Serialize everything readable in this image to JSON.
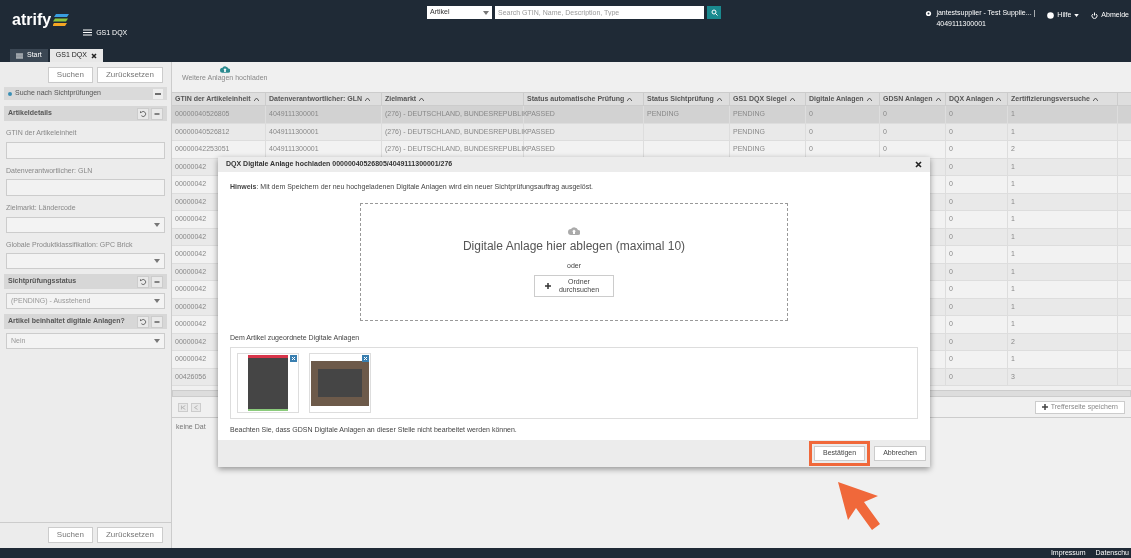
{
  "header": {
    "logo": "atrify",
    "app_title": "GS1 DQX",
    "search": {
      "scope": "Artikel",
      "placeholder": "Search GTIN, Name, Description, Type"
    },
    "user": {
      "name": "jantestsupplier - Test Supplie... |",
      "gln": "4049111300001"
    },
    "help": "Hilfe",
    "logout": "Abmelde"
  },
  "tabs": [
    {
      "label": "Start",
      "selected": false,
      "closable": false
    },
    {
      "label": "GS1 DQX",
      "selected": true,
      "closable": true
    }
  ],
  "sidebar": {
    "top_buttons": [
      "Suchen",
      "Zurücksetzen"
    ],
    "title": "Suche nach Sichtprüfungen",
    "expanded": true,
    "sections": [
      {
        "title": "Artikeldetails",
        "fields": [
          {
            "kind": "text",
            "label": "GTIN der Artikeleinheit"
          },
          {
            "kind": "text",
            "label": "Datenverantwortlicher: GLN"
          },
          {
            "kind": "select",
            "label": "Zielmarkt: Ländercode"
          },
          {
            "kind": "select",
            "label": "Globale Produktklassifikation: GPC Brick"
          }
        ]
      },
      {
        "title": "Sichtprüfungsstatus",
        "fields": [
          {
            "kind": "select",
            "value": "(PENDING) - Ausstehend"
          }
        ]
      },
      {
        "title": "Artikel beinhaltet digitale Anlagen?",
        "fields": [
          {
            "kind": "select",
            "value": "Nein"
          }
        ]
      }
    ],
    "bottom_buttons": [
      "Suchen",
      "Zurücksetzen"
    ]
  },
  "toolbar": {
    "upload_label": "Weitere Anlagen hochladen"
  },
  "table": {
    "columns": [
      "GTIN der Artikeleinheit",
      "Datenverantwortlicher: GLN",
      "Zielmarkt",
      "Status automatische Prüfung",
      "Status Sichtprüfung",
      "GS1 DQX Siegel",
      "Digitale Anlagen",
      "GDSN Anlagen",
      "DQX Anlagen",
      "Zertifizierungsversuche"
    ],
    "rows": [
      {
        "selected": true,
        "cells": [
          "00000040526805",
          "4049111300001",
          "(276) - DEUTSCHLAND, BUNDESREPUBLIK",
          "PASSED",
          "PENDING",
          "PENDING",
          "0",
          "0",
          "0",
          "1"
        ]
      },
      {
        "selected": false,
        "cells": [
          "00000040526812",
          "4049111300001",
          "(276) - DEUTSCHLAND, BUNDESREPUBLIK",
          "PASSED",
          null,
          "PENDING",
          "0",
          "0",
          "0",
          "1"
        ]
      },
      {
        "selected": false,
        "cells": [
          "00000042253051",
          "4049111300001",
          "(276) - DEUTSCHLAND, BUNDESREPUBLIK",
          "PASSED",
          null,
          "PENDING",
          "0",
          "0",
          "0",
          "2"
        ]
      },
      {
        "selected": false,
        "cells": [
          "00000042",
          null,
          null,
          null,
          null,
          null,
          null,
          null,
          "0",
          "1"
        ]
      },
      {
        "selected": false,
        "cells": [
          "00000042",
          null,
          null,
          null,
          null,
          null,
          null,
          null,
          "0",
          "1"
        ]
      },
      {
        "selected": false,
        "cells": [
          "00000042",
          null,
          null,
          null,
          null,
          null,
          null,
          null,
          "0",
          "1"
        ]
      },
      {
        "selected": false,
        "cells": [
          "00000042",
          null,
          null,
          null,
          null,
          null,
          null,
          null,
          "0",
          "1"
        ]
      },
      {
        "selected": false,
        "cells": [
          "00000042",
          null,
          null,
          null,
          null,
          null,
          null,
          null,
          "0",
          "1"
        ]
      },
      {
        "selected": false,
        "cells": [
          "00000042",
          null,
          null,
          null,
          null,
          null,
          null,
          null,
          "0",
          "1"
        ]
      },
      {
        "selected": false,
        "cells": [
          "00000042",
          null,
          null,
          null,
          null,
          null,
          null,
          null,
          "0",
          "1"
        ]
      },
      {
        "selected": false,
        "cells": [
          "00000042",
          null,
          null,
          null,
          null,
          null,
          null,
          null,
          "0",
          "1"
        ]
      },
      {
        "selected": false,
        "cells": [
          "00000042",
          null,
          null,
          null,
          null,
          null,
          null,
          null,
          "0",
          "1"
        ]
      },
      {
        "selected": false,
        "cells": [
          "00000042",
          null,
          null,
          null,
          null,
          null,
          null,
          null,
          "0",
          "1"
        ]
      },
      {
        "selected": false,
        "cells": [
          "00000042",
          null,
          null,
          null,
          null,
          null,
          null,
          null,
          "0",
          "2"
        ]
      },
      {
        "selected": false,
        "cells": [
          "00000042",
          null,
          null,
          null,
          null,
          null,
          null,
          null,
          "0",
          "1"
        ]
      },
      {
        "selected": false,
        "cells": [
          "00426056",
          null,
          null,
          null,
          null,
          null,
          null,
          null,
          "0",
          "3"
        ]
      }
    ],
    "no_data": "keine Dat",
    "save_button": "Trefferseite speichern"
  },
  "dialog": {
    "title": "DQX Digitale Anlage hochladen 00000040526805/4049111300001/276",
    "hint": "**Hinweis**: Mit dem Speichern der neu hochgeladenen Digitale Anlagen wird ein neuer Sichtprüfungsauftrag ausgelöst.",
    "drop_text": "Digitale Anlage hier ablegen (maximal 10)",
    "or": "oder",
    "browse_button": "Ordner durchsuchen",
    "attachments_label": "Dem Artikel zugeordnete Digitale Anlagen",
    "attachments": [
      {
        "kind": "portrait"
      },
      {
        "kind": "landscape"
      }
    ],
    "note": "Beachten Sie, dass GDSN Digitale Anlagen an dieser Stelle nicht bearbeitet werden können.",
    "buttons": [
      {
        "label": "Bestätigen",
        "highlighted": true
      },
      {
        "label": "Abbrechen",
        "highlighted": false
      }
    ]
  },
  "footer": {
    "links": [
      "Impressum",
      "Datenschu"
    ]
  }
}
